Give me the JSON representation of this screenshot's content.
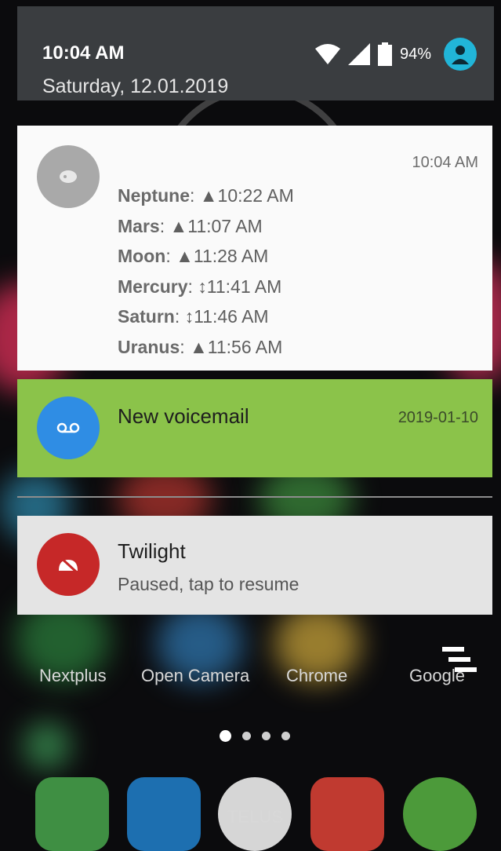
{
  "status": {
    "time": "10:04 AM",
    "date": "Saturday, 12.01.2019",
    "battery": "94%"
  },
  "notifications": {
    "planets": {
      "time": "10:04 AM",
      "items": [
        {
          "name": "Neptune",
          "rest": ": ▲10:22 AM"
        },
        {
          "name": "Mars",
          "rest": ": ▲11:07 AM"
        },
        {
          "name": "Moon",
          "rest": ": ▲11:28 AM"
        },
        {
          "name": "Mercury",
          "rest": ": ↕11:41 AM"
        },
        {
          "name": "Saturn",
          "rest": ": ↕11:46 AM"
        },
        {
          "name": "Uranus",
          "rest": ": ▲11:56 AM"
        }
      ]
    },
    "voicemail": {
      "title": "New voicemail",
      "date": "2019-01-10"
    },
    "twilight": {
      "title": "Twilight",
      "subtitle": "Paused, tap to resume"
    }
  },
  "home": {
    "apps": [
      "Nextplus",
      "Open Camera",
      "Chrome",
      "Google"
    ],
    "carrier": "TELUS"
  },
  "colors": {
    "voicemail_bg": "#8bc34a",
    "voicemail_icon": "#2f8de4",
    "twilight_icon": "#c62828",
    "avatar": "#21b5d8"
  }
}
